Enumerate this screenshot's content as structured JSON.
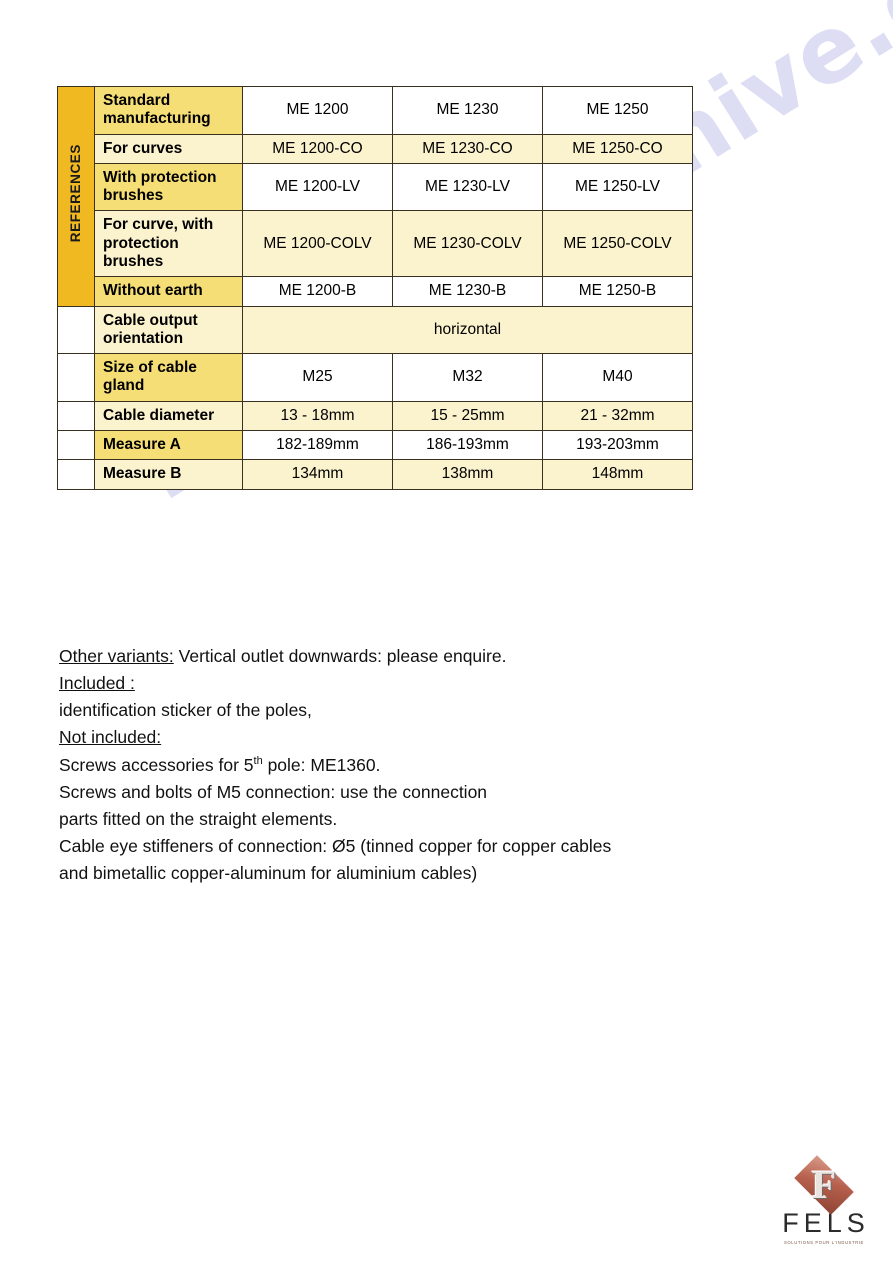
{
  "watermark": {
    "text": "manualsarchive.com"
  },
  "table": {
    "side_label": "REFERENCES",
    "columns": [
      "ME 1200",
      "ME 1230",
      "ME 1250"
    ],
    "rows": [
      {
        "label": "Standard manufacturing",
        "values": [
          "ME 1200",
          "ME 1230",
          "ME 1250"
        ],
        "shade": "dark"
      },
      {
        "label": "For curves",
        "values": [
          "ME 1200-CO",
          "ME 1230-CO",
          "ME 1250-CO"
        ],
        "shade": "light"
      },
      {
        "label": "With protection brushes",
        "values": [
          "ME 1200-LV",
          "ME 1230-LV",
          "ME 1250-LV"
        ],
        "shade": "dark"
      },
      {
        "label": "For curve, with protection brushes",
        "values": [
          "ME 1200-COLV",
          "ME 1230-COLV",
          "ME 1250-COLV"
        ],
        "shade": "light"
      },
      {
        "label": "Without earth",
        "values": [
          "ME 1200-B",
          "ME 1230-B",
          "ME 1250-B"
        ],
        "shade": "dark"
      },
      {
        "label": "Cable output orientation",
        "values": [
          "horizontal"
        ],
        "span": true,
        "shade": "light"
      },
      {
        "label": "Size of cable gland",
        "values": [
          "M25",
          "M32",
          "M40"
        ],
        "shade": "dark"
      },
      {
        "label": "Cable diameter",
        "values": [
          "13 - 18mm",
          "15 - 25mm",
          "21 - 32mm"
        ],
        "shade": "light"
      },
      {
        "label": "Measure A",
        "values": [
          "182-189mm",
          "186-193mm",
          "193-203mm"
        ],
        "shade": "dark"
      },
      {
        "label": "Measure B",
        "values": [
          "134mm",
          "138mm",
          "148mm"
        ],
        "shade": "light"
      }
    ]
  },
  "notes": {
    "line1_head": "Other variants:",
    "line1_rest": " Vertical outlet downwards: please enquire.",
    "line2_head": "Included :",
    "line3": "identification sticker of the poles,",
    "line4_head": "Not included:",
    "line5_a": "Screws accessories for 5",
    "line5_sup": "th",
    "line5_b": " pole: ME1360.",
    "line6": "Screws and bolts of M5 connection: use the connection",
    "line7": "parts fitted on the straight elements.",
    "line8": "Cable eye stiffeners of connection: Ø5 (tinned copper for  copper cables",
    "line9": "and bimetallic copper-aluminum for aluminium cables)"
  },
  "logo": {
    "mark_letter": "F",
    "wordmark": "FELS",
    "tagline": "SOLUTIONS POUR L'INDUSTRIE"
  },
  "colors": {
    "ref_gold": "#F0B922",
    "row_dark": "#F5DE76",
    "row_light": "#FBF2CE",
    "row_white": "#FFFFFF",
    "border": "#3A3020",
    "watermark": "#C9C9EE"
  }
}
